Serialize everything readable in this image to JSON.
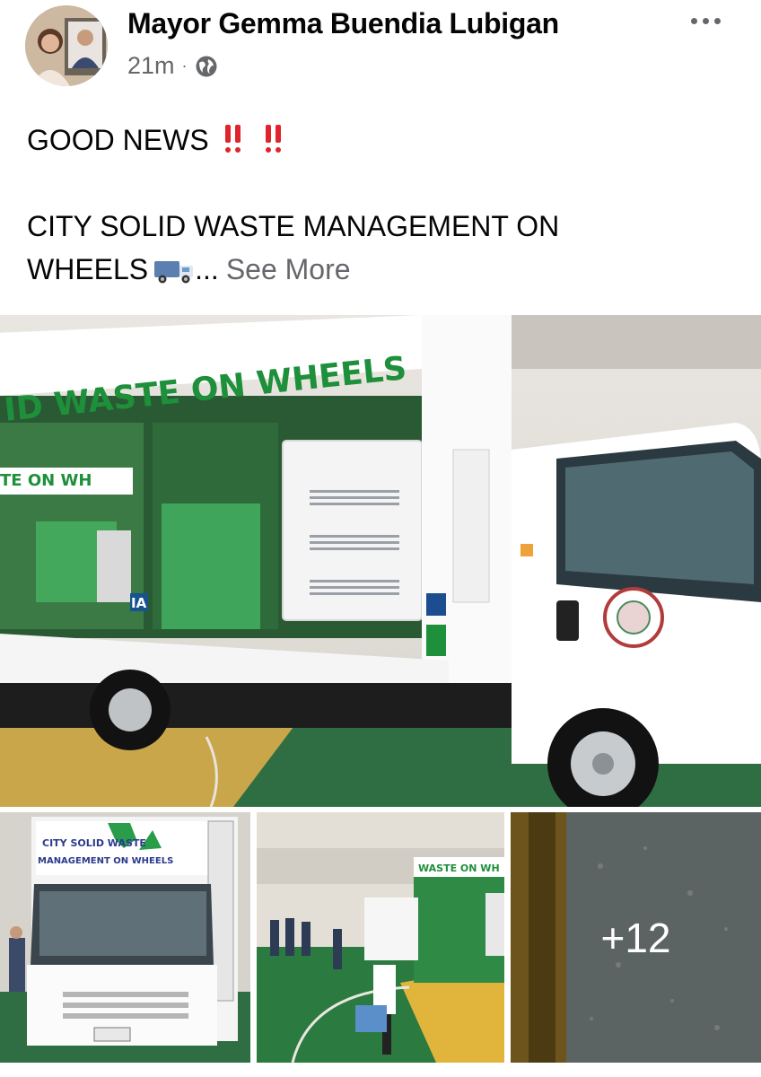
{
  "post": {
    "author_name": "Mayor Gemma Buendia Lubigan",
    "timestamp": "21m",
    "separator": "·",
    "privacy_icon": "globe-icon",
    "menu_icon": "more-horizontal-icon"
  },
  "content": {
    "line1": "GOOD NEWS",
    "line1_emoji": "double-exclamation-icon",
    "line2": "CITY SOLID WASTE MANAGEMENT ON",
    "line3": "WHEELS",
    "line3_emoji": "truck-emoji",
    "ellipsis": "...",
    "see_more": "See More"
  },
  "photos": {
    "main_banner_text": "ID WASTE ON WHEELS",
    "main_banner_text_2": "TE ON WH",
    "main_side_tag": "IA",
    "thumb1_sign_line1": "CITY SOLID WASTE",
    "thumb1_sign_line2": "MANAGEMENT ON WHEELS",
    "thumb2_sign": "WASTE ON WH",
    "more_count": "+12"
  },
  "colors": {
    "text_primary": "#050505",
    "text_secondary": "#65676b",
    "accent_green": "#1e8f3a",
    "emoji_red": "#e0242b"
  }
}
